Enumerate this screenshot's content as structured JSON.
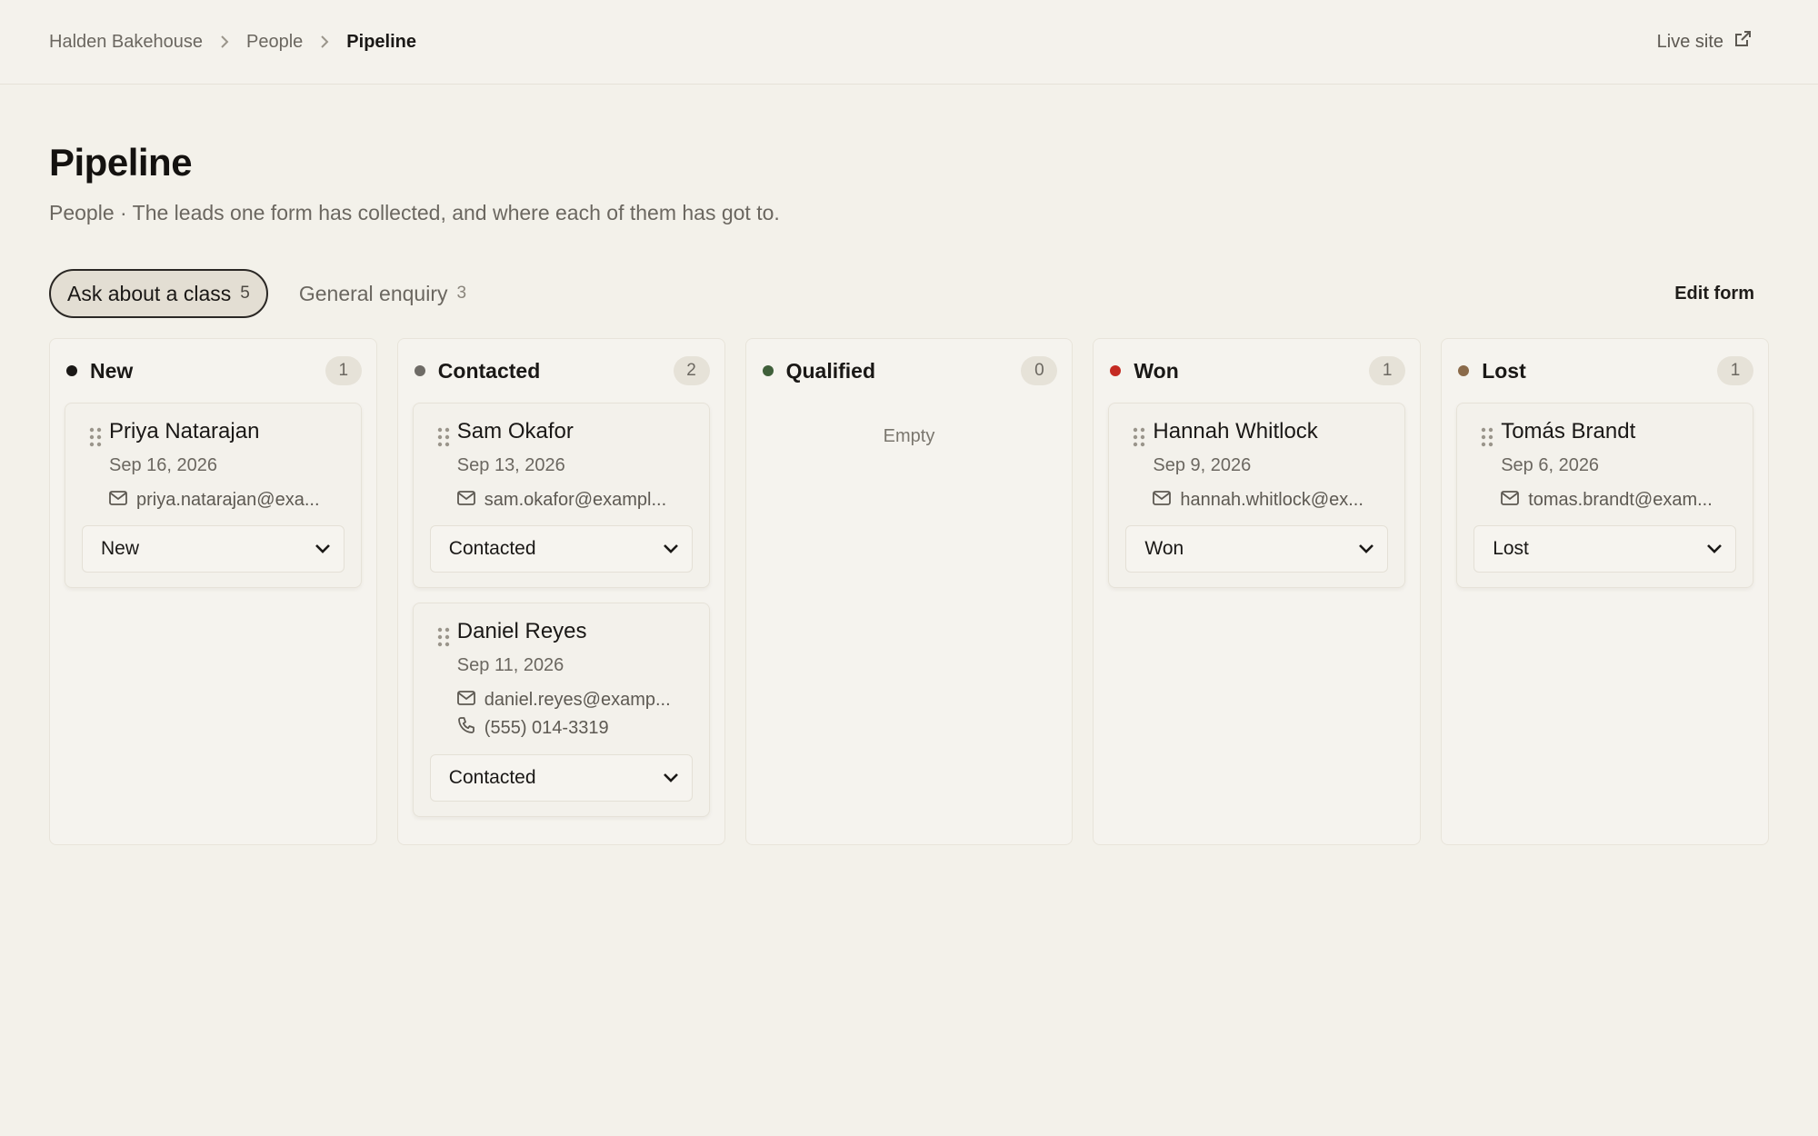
{
  "breadcrumb": {
    "items": [
      "Halden Bakehouse",
      "People"
    ],
    "current": "Pipeline"
  },
  "header": {
    "live_site_label": "Live site"
  },
  "page": {
    "title": "Pipeline",
    "subtitle": "People · The leads one form has collected, and where each of them has got to."
  },
  "tabs": [
    {
      "label": "Ask about a class",
      "count": "5",
      "active": true
    },
    {
      "label": "General enquiry",
      "count": "3",
      "active": false
    }
  ],
  "edit_form_label": "Edit form",
  "colors": {
    "new": "#1a1816",
    "contacted": "#6e6b66",
    "qualified": "#3f5f3a",
    "won": "#c42a22",
    "lost": "#8a6a4a"
  },
  "board": {
    "empty_label": "Empty",
    "columns": [
      {
        "title": "New",
        "count": "1",
        "cards": [
          {
            "name": "Priya Natarajan",
            "date": "Sep 16, 2026",
            "email": "priya.natarajan@exa...",
            "status": "New"
          }
        ]
      },
      {
        "title": "Contacted",
        "count": "2",
        "cards": [
          {
            "name": "Sam Okafor",
            "date": "Sep 13, 2026",
            "email": "sam.okafor@exampl...",
            "status": "Contacted"
          },
          {
            "name": "Daniel Reyes",
            "date": "Sep 11, 2026",
            "email": "daniel.reyes@examp...",
            "phone": "(555) 014-3319",
            "status": "Contacted"
          }
        ]
      },
      {
        "title": "Qualified",
        "count": "0",
        "cards": []
      },
      {
        "title": "Won",
        "count": "1",
        "cards": [
          {
            "name": "Hannah Whitlock",
            "date": "Sep 9, 2026",
            "email": "hannah.whitlock@ex...",
            "status": "Won"
          }
        ]
      },
      {
        "title": "Lost",
        "count": "1",
        "cards": [
          {
            "name": "Tomás Brandt",
            "date": "Sep 6, 2026",
            "email": "tomas.brandt@exam...",
            "status": "Lost"
          }
        ]
      }
    ]
  }
}
